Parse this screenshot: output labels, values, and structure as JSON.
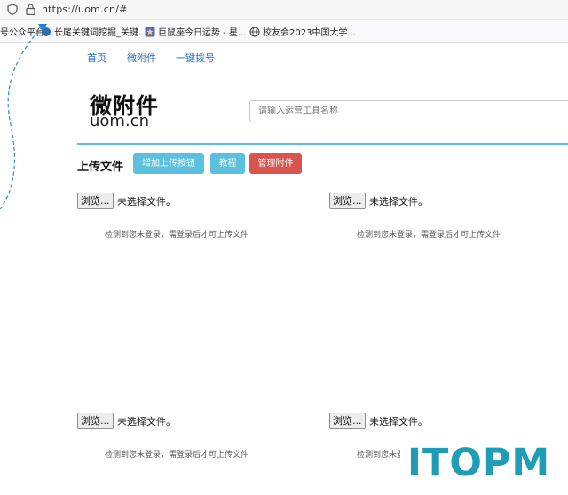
{
  "browser": {
    "url": "https://uom.cn/#",
    "bookmarks": [
      {
        "label": "号公众平台..."
      },
      {
        "label": "长尾关键词挖掘_关键..."
      },
      {
        "label": "巨鼠座今日运势 - 星..."
      },
      {
        "label": "校友会2023中国大学..."
      }
    ]
  },
  "nav": {
    "items": [
      {
        "label": "首页"
      },
      {
        "label": "微附件"
      },
      {
        "label": "一键拨号"
      }
    ]
  },
  "header": {
    "title": "微附件",
    "subtitle": "uom.cn",
    "search_placeholder": "请输入运营工具名称"
  },
  "toolbar": {
    "label": "上传文件",
    "add_button": "增加上传按钮",
    "tutorial_button": "教程",
    "manage_button": "管理附件"
  },
  "uploads": {
    "browse_label": "浏览...",
    "no_file_text": "未选择文件。",
    "login_hint": "检测到您未登录，需登录后才可上传文件"
  },
  "colors": {
    "accent": "#5bc0de",
    "danger": "#d9534f",
    "link": "#2c6cb5"
  },
  "watermark": {
    "text": "ITOPM"
  }
}
